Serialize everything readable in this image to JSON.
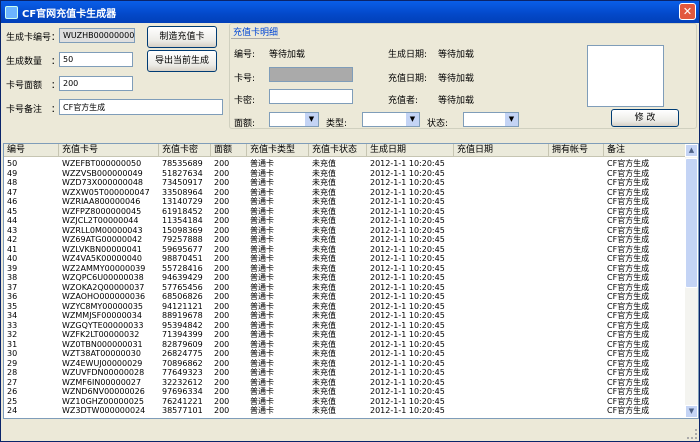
{
  "window": {
    "title": "CF官网充值卡生成器",
    "close": "✕"
  },
  "left_panel": {
    "code_label": "生成卡编号",
    "code_value": "WUZHB00000000000",
    "count_label": "生成数量",
    "count_value": "50",
    "face_label": "卡号面额",
    "face_value": "200",
    "note_label": "卡号备注",
    "note_value": "CF官方生成",
    "colon": "：",
    "gen_button": "制造充值卡",
    "export_button": "导出当前生成"
  },
  "detail": {
    "title": "充值卡明细",
    "id_label": "编号:",
    "id_value": "等待加载",
    "gen_date_label": "生成日期:",
    "gen_date_value": "等待加载",
    "card_label": "卡号:",
    "recharge_date_label": "充值日期:",
    "recharge_date_value": "等待加载",
    "pwd_label": "卡密:",
    "recharger_label": "充值者:",
    "recharger_value": "等待加载",
    "face_label": "面额:",
    "type_label": "类型:",
    "state_label": "状态:",
    "edit_button": "修 改"
  },
  "table": {
    "columns": [
      "编号",
      "充值卡号",
      "充值卡密",
      "面额",
      "充值卡类型",
      "充值卡状态",
      "生成日期",
      "充值日期",
      "拥有帐号",
      "备注"
    ],
    "rows": [
      [
        "50",
        "WZEFBT000000050",
        "78535689",
        "200",
        "普通卡",
        "未充值",
        "2012-1-1  10:20:45",
        "",
        "",
        "CF官方生成"
      ],
      [
        "49",
        "WZZVSB000000049",
        "51827634",
        "200",
        "普通卡",
        "未充值",
        "2012-1-1  10:20:45",
        "",
        "",
        "CF官方生成"
      ],
      [
        "48",
        "WZD73X000000048",
        "73450917",
        "200",
        "普通卡",
        "未充值",
        "2012-1-1  10:20:45",
        "",
        "",
        "CF官方生成"
      ],
      [
        "47",
        "WZXW05T000000047",
        "33508964",
        "200",
        "普通卡",
        "未充值",
        "2012-1-1  10:20:45",
        "",
        "",
        "CF官方生成"
      ],
      [
        "46",
        "WZRIAA800000046",
        "13140729",
        "200",
        "普通卡",
        "未充值",
        "2012-1-1  10:20:45",
        "",
        "",
        "CF官方生成"
      ],
      [
        "45",
        "WZFPZ8000000045",
        "61918452",
        "200",
        "普通卡",
        "未充值",
        "2012-1-1  10:20:45",
        "",
        "",
        "CF官方生成"
      ],
      [
        "44",
        "WZJCL2T00000044",
        "11354184",
        "200",
        "普通卡",
        "未充值",
        "2012-1-1  10:20:45",
        "",
        "",
        "CF官方生成"
      ],
      [
        "43",
        "WZRLL0M00000043",
        "15098369",
        "200",
        "普通卡",
        "未充值",
        "2012-1-1  10:20:45",
        "",
        "",
        "CF官方生成"
      ],
      [
        "42",
        "WZ69ATG00000042",
        "79257888",
        "200",
        "普通卡",
        "未充值",
        "2012-1-1  10:20:45",
        "",
        "",
        "CF官方生成"
      ],
      [
        "41",
        "WZLVKBN00000041",
        "59695677",
        "200",
        "普通卡",
        "未充值",
        "2012-1-1  10:20:45",
        "",
        "",
        "CF官方生成"
      ],
      [
        "40",
        "WZ4VA5K00000040",
        "98870451",
        "200",
        "普通卡",
        "未充值",
        "2012-1-1  10:20:45",
        "",
        "",
        "CF官方生成"
      ],
      [
        "39",
        "WZ2AMMY00000039",
        "55728416",
        "200",
        "普通卡",
        "未充值",
        "2012-1-1  10:20:45",
        "",
        "",
        "CF官方生成"
      ],
      [
        "38",
        "WZQPC6U00000038",
        "94639429",
        "200",
        "普通卡",
        "未充值",
        "2012-1-1  10:20:45",
        "",
        "",
        "CF官方生成"
      ],
      [
        "37",
        "WZOKA2Q00000037",
        "57765456",
        "200",
        "普通卡",
        "未充值",
        "2012-1-1  10:20:45",
        "",
        "",
        "CF官方生成"
      ],
      [
        "36",
        "WZAOHO000000036",
        "68506826",
        "200",
        "普通卡",
        "未充值",
        "2012-1-1  10:20:45",
        "",
        "",
        "CF官方生成"
      ],
      [
        "35",
        "WZYC8MY00000035",
        "94121121",
        "200",
        "普通卡",
        "未充值",
        "2012-1-1  10:20:45",
        "",
        "",
        "CF官方生成"
      ],
      [
        "34",
        "WZMMJSF00000034",
        "88919678",
        "200",
        "普通卡",
        "未充值",
        "2012-1-1  10:20:45",
        "",
        "",
        "CF官方生成"
      ],
      [
        "33",
        "WZGQYTE00000033",
        "95394842",
        "200",
        "普通卡",
        "未充值",
        "2012-1-1  10:20:45",
        "",
        "",
        "CF官方生成"
      ],
      [
        "32",
        "WZFK2LT00000032",
        "71394399",
        "200",
        "普通卡",
        "未充值",
        "2012-1-1  10:20:45",
        "",
        "",
        "CF官方生成"
      ],
      [
        "31",
        "WZ0TBN000000031",
        "82879609",
        "200",
        "普通卡",
        "未充值",
        "2012-1-1  10:20:45",
        "",
        "",
        "CF官方生成"
      ],
      [
        "30",
        "WZT38AT00000030",
        "26824775",
        "200",
        "普通卡",
        "未充值",
        "2012-1-1  10:20:45",
        "",
        "",
        "CF官方生成"
      ],
      [
        "29",
        "WZ4EWUJ00000029",
        "70896862",
        "200",
        "普通卡",
        "未充值",
        "2012-1-1  10:20:45",
        "",
        "",
        "CF官方生成"
      ],
      [
        "28",
        "WZUVFDN00000028",
        "77649323",
        "200",
        "普通卡",
        "未充值",
        "2012-1-1  10:20:45",
        "",
        "",
        "CF官方生成"
      ],
      [
        "27",
        "WZMF6IN00000027",
        "32232612",
        "200",
        "普通卡",
        "未充值",
        "2012-1-1  10:20:45",
        "",
        "",
        "CF官方生成"
      ],
      [
        "26",
        "WZND6NV00000026",
        "97696334",
        "200",
        "普通卡",
        "未充值",
        "2012-1-1  10:20:45",
        "",
        "",
        "CF官方生成"
      ],
      [
        "25",
        "WZ10GHZ00000025",
        "76241221",
        "200",
        "普通卡",
        "未充值",
        "2012-1-1  10:20:45",
        "",
        "",
        "CF官方生成"
      ],
      [
        "24",
        "WZ3DTW000000024",
        "38577101",
        "200",
        "普通卡",
        "未充值",
        "2012-1-1  10:20:45",
        "",
        "",
        "CF官方生成"
      ]
    ]
  },
  "scrollbar": {
    "up": "▲",
    "down": "▼"
  },
  "select_arrow": "▼"
}
